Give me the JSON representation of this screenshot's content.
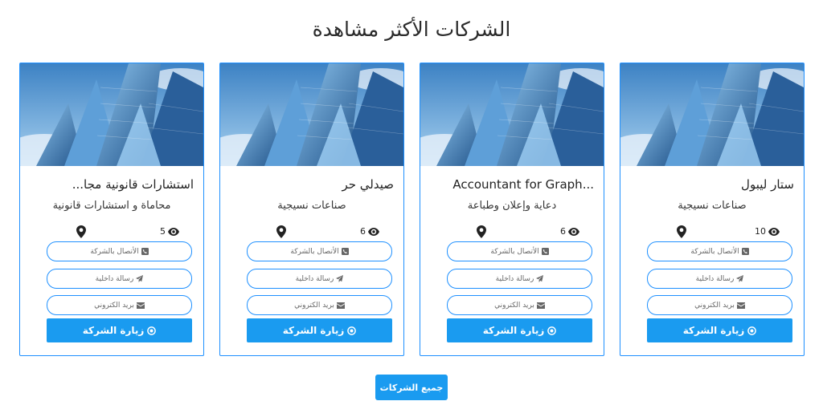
{
  "section": {
    "title": "الشركات الأكثر مشاهدة"
  },
  "companies": [
    {
      "name": "ستار ليبول",
      "category": "صناعات نسيجية",
      "views": "10",
      "call_label": "الأتصال بالشركة",
      "message_label": "رسالة داخلية",
      "email_label": "بريد الكتروني",
      "visit_label": "زيارة الشركة"
    },
    {
      "name": "Accountant for Graph...",
      "category": "دعاية وإعلان وطباعة",
      "views": "6",
      "call_label": "الأتصال بالشركة",
      "message_label": "رسالة داخلية",
      "email_label": "بريد الكتروني",
      "visit_label": "زيارة الشركة"
    },
    {
      "name": "صيدلي حر",
      "category": "صناعات نسيجية",
      "views": "6",
      "call_label": "الأتصال بالشركة",
      "message_label": "رسالة داخلية",
      "email_label": "بريد الكتروني",
      "visit_label": "زيارة الشركة"
    },
    {
      "name": "استشارات قانونية مجا...",
      "category": "محاماة و استشارات قانونية",
      "views": "5",
      "call_label": "الأتصال بالشركة",
      "message_label": "رسالة داخلية",
      "email_label": "بريد الكتروني",
      "visit_label": "زيارة الشركة"
    }
  ],
  "footer": {
    "all_companies_label": "جميع الشركات"
  },
  "colors": {
    "accent": "#1a9bf0",
    "border": "#1e90ff"
  },
  "icons": {
    "image": "building-photo",
    "location": "map-marker-icon",
    "views": "eye-icon",
    "call": "phone-icon",
    "message": "paper-plane-icon",
    "email": "envelope-icon",
    "visit": "dot-circle-icon"
  }
}
